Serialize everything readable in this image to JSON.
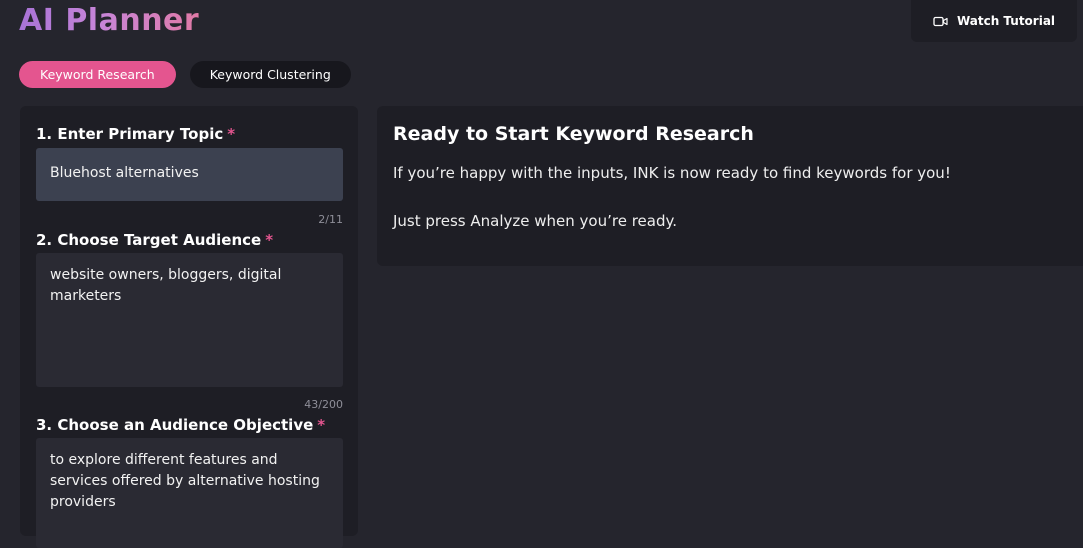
{
  "app": {
    "title": "AI Planner"
  },
  "header": {
    "tutorial_label": "Watch Tutorial",
    "tutorial_icon": "video-camera-icon"
  },
  "tabs": [
    {
      "label": "Keyword Research",
      "active": true
    },
    {
      "label": "Keyword Clustering",
      "active": false
    }
  ],
  "form": {
    "primary_topic": {
      "label": "1. Enter Primary Topic",
      "required_mark": "*",
      "value": "Bluehost alternatives",
      "counter": "2/11"
    },
    "target_audience": {
      "label": "2. Choose Target Audience",
      "required_mark": "*",
      "value": "website owners, bloggers, digital\nmarketers",
      "counter": "43/200"
    },
    "audience_objective": {
      "label": "3. Choose an Audience Objective",
      "required_mark": "*",
      "value": "to explore different features and\nservices offered by alternative hosting\nproviders"
    }
  },
  "info_panel": {
    "title": "Ready to Start Keyword Research",
    "line1": "If you’re happy with the inputs, INK is now ready to find keywords for you!",
    "line2": "Just press Analyze when you’re ready."
  },
  "colors": {
    "accent": "#e4558f",
    "background": "#25252d",
    "panel": "#1e1e25",
    "input_active": "#3c4150",
    "input": "#2a2a33"
  }
}
